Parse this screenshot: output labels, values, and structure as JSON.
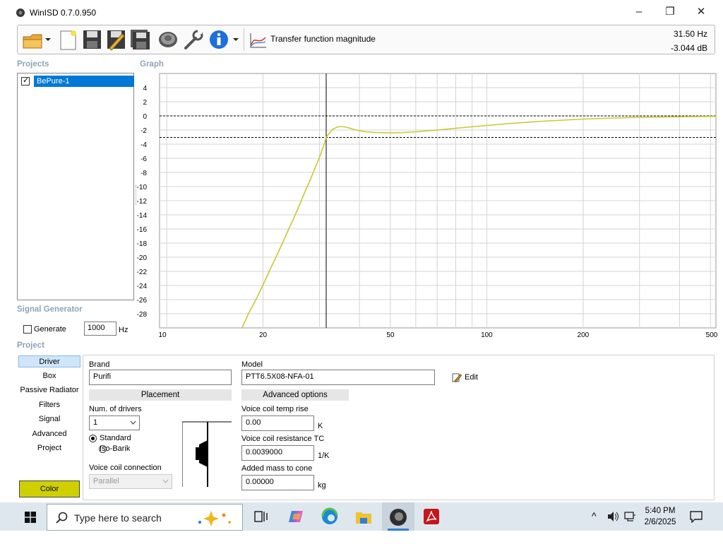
{
  "window": {
    "title": "WinISD 0.7.0.950",
    "minimize": "–",
    "maximize": "❐",
    "close": "✕"
  },
  "toolbar": {
    "graph_selector_label": "Transfer function magnitude",
    "readout_freq": "31.50 Hz",
    "readout_db": "-3.044 dB",
    "icons": [
      "open-folder-icon",
      "new-document-icon",
      "save-icon",
      "save-as-icon",
      "save-all-icon",
      "speaker-icon",
      "wrench-icon",
      "info-icon",
      "graph-icon"
    ]
  },
  "projects": {
    "header": "Projects",
    "items": [
      {
        "label": "BePure-1",
        "checked": true
      }
    ]
  },
  "graph": {
    "header": "Graph"
  },
  "signal_generator": {
    "header": "Signal Generator",
    "generate_label": "Generate",
    "frequency_value": "1000",
    "frequency_unit": "Hz"
  },
  "chart_data": {
    "type": "line",
    "title": "",
    "xlabel": "",
    "ylabel": "",
    "x_scale": "log",
    "xlim": [
      9.5,
      520
    ],
    "ylim": [
      -30,
      6
    ],
    "x_ticks": [
      "10",
      "20",
      "50",
      "100",
      "200",
      "500"
    ],
    "x_tick_values": [
      10,
      20,
      50,
      100,
      200,
      500
    ],
    "y_ticks": [
      "4",
      "2",
      "0",
      "-2",
      "-4",
      "-6",
      "-8",
      "-10",
      "-12",
      "-14",
      "-16",
      "-18",
      "-20",
      "-22",
      "-24",
      "-26",
      "-28"
    ],
    "y_tick_values": [
      4,
      2,
      0,
      -2,
      -4,
      -6,
      -8,
      -10,
      -12,
      -14,
      -16,
      -18,
      -20,
      -22,
      -24,
      -26,
      -28
    ],
    "grid": true,
    "reference_lines_db": [
      0,
      -3.044
    ],
    "cursor_freq": 31.5,
    "series": [
      {
        "color": "#c9c830",
        "x": [
          17.2,
          18,
          19,
          20,
          21,
          22,
          23,
          24,
          25,
          26,
          27,
          28,
          29,
          30,
          31,
          31.5,
          32,
          33,
          34,
          35,
          36,
          37,
          38,
          40,
          42,
          45,
          50,
          55,
          60,
          70,
          80,
          100,
          120,
          150,
          200,
          250,
          300,
          400,
          500,
          520
        ],
        "y": [
          -30.0,
          -28.0,
          -26.0,
          -23.9,
          -21.8,
          -19.9,
          -18.0,
          -16.1,
          -14.4,
          -12.6,
          -10.8,
          -9.2,
          -7.5,
          -5.9,
          -4.1,
          -3.044,
          -2.6,
          -1.9,
          -1.6,
          -1.5,
          -1.55,
          -1.7,
          -1.85,
          -2.1,
          -2.25,
          -2.35,
          -2.4,
          -2.35,
          -2.25,
          -2.0,
          -1.75,
          -1.35,
          -1.05,
          -0.75,
          -0.45,
          -0.3,
          -0.2,
          -0.12,
          -0.08,
          -0.07
        ]
      }
    ]
  },
  "project": {
    "header": "Project",
    "tabs": [
      "Driver",
      "Box",
      "Passive Radiator",
      "Filters",
      "Signal",
      "Advanced",
      "Project"
    ],
    "active_tab": "Driver",
    "color_button": "Color",
    "color_value": "#d0d000"
  },
  "driver": {
    "brand_label": "Brand",
    "brand_value": "Purifi",
    "model_label": "Model",
    "model_value": "PTT6.5X08-NFA-01",
    "edit_label": "Edit",
    "placement_header": "Placement",
    "num_drivers_label": "Num. of drivers",
    "num_drivers_value": "1",
    "standard_label": "Standard",
    "isobarik_label": "Iso-Barik",
    "vc_connection_label": "Voice coil connection",
    "vc_connection_value": "Parallel",
    "advanced_header": "Advanced options",
    "vc_temp_rise_label": "Voice coil temp rise",
    "vc_temp_rise_value": "0.00",
    "vc_temp_rise_unit": "K",
    "vc_res_tc_label": "Voice coil resistance TC",
    "vc_res_tc_value": "0.0039000",
    "vc_res_tc_unit": "1/K",
    "added_mass_label": "Added mass to cone",
    "added_mass_value": "0.00000",
    "added_mass_unit": "kg"
  },
  "taskbar": {
    "search_placeholder": "Type here to search",
    "time": "5:40 PM",
    "date": "2/6/2025"
  }
}
